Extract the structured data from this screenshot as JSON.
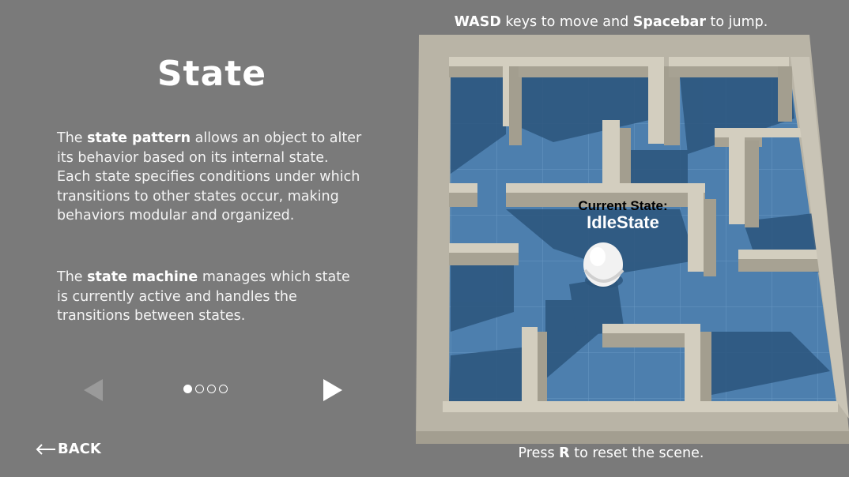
{
  "panel": {
    "title": "State",
    "paragraph1": {
      "pre": "The ",
      "bold": "state pattern",
      "post": " allows an object to alter its behavior based on its internal state. Each state specifies conditions under which transitions to other states occur, making behaviors modular and organized."
    },
    "paragraph2": {
      "pre": "The ",
      "bold": "state machine",
      "post": " manages which state is currently active and handles the transitions between states."
    },
    "pagination": {
      "current": 1,
      "total": 4
    },
    "back_label": "BACK"
  },
  "instructions": {
    "top": {
      "key1": "WASD",
      "text1": " keys to move and ",
      "key2": "Spacebar",
      "text2": " to jump."
    },
    "bottom": {
      "pre": "Press ",
      "key": "R",
      "post": " to reset the scene."
    }
  },
  "game": {
    "state_caption": "Current State:",
    "state_value": "IdleState"
  },
  "colors": {
    "background": "#7a7a7a",
    "maze_wall": "#c9c4b6",
    "maze_floor": "#4d7fae",
    "maze_floor_shadow": "#2c557c",
    "player": "#f2f2f2"
  },
  "icons": [
    "prev-arrow-icon",
    "next-arrow-icon",
    "back-arrow-icon"
  ]
}
